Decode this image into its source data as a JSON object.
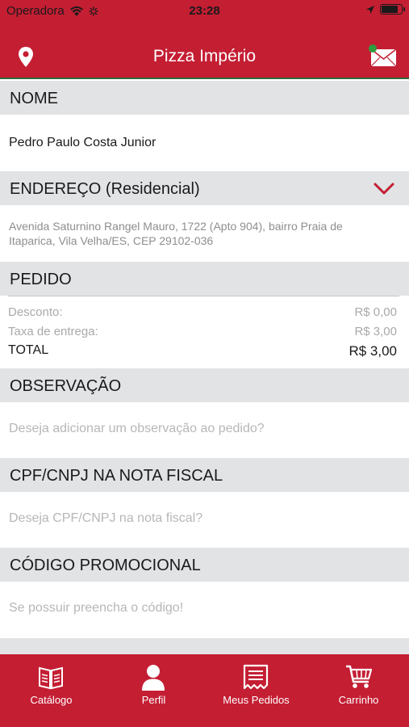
{
  "status_bar": {
    "carrier": "Operadora",
    "time": "23:28",
    "battery_level": 0.85
  },
  "nav": {
    "title": "Pizza Império",
    "left_icon": "location-pin-icon",
    "right_icon": "mail-icon"
  },
  "sections": {
    "nome": {
      "header": "NOME",
      "value": "Pedro Paulo Costa Junior"
    },
    "endereco": {
      "header": "ENDEREÇO (Residencial)",
      "line1": "Avenida Saturnino Rangel Mauro, 1722 (Apto 904), bairro Praia de",
      "line2": "Itaparica, Vila Velha/ES, CEP 29102-036"
    },
    "pedido": {
      "header": "PEDIDO",
      "rows": [
        {
          "label": "Desconto:",
          "value": "R$ 0,00"
        },
        {
          "label": "Taxa de entrega:",
          "value": "R$ 3,00"
        },
        {
          "label": "TOTAL",
          "value": "R$ 3,00"
        }
      ]
    },
    "observacao": {
      "header": "OBSERVAÇÃO",
      "placeholder": "Deseja adicionar um observação ao pedido?"
    },
    "cpf": {
      "header": "CPF/CNPJ NA NOTA FISCAL",
      "placeholder": "Deseja CPF/CNPJ na nota fiscal?"
    },
    "promo": {
      "header": "CÓDIGO PROMOCIONAL",
      "placeholder": "Se possuir preencha o código!"
    }
  },
  "tabs": [
    {
      "label": "Catálogo",
      "icon": "book-icon"
    },
    {
      "label": "Perfil",
      "icon": "person-icon"
    },
    {
      "label": "Meus Pedidos",
      "icon": "receipt-icon"
    },
    {
      "label": "Carrinho",
      "icon": "cart-icon"
    }
  ],
  "colors": {
    "brand_red": "#c41e33",
    "section_gray": "#e2e3e5",
    "notification_green": "#2e9c3e"
  }
}
